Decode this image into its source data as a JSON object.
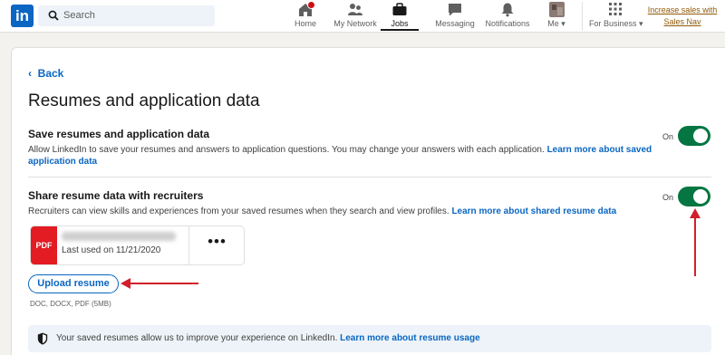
{
  "nav": {
    "logo": "in",
    "search_placeholder": "Search",
    "items": [
      {
        "label": "Home",
        "icon": "home-icon"
      },
      {
        "label": "My Network",
        "icon": "network-icon"
      },
      {
        "label": "Jobs",
        "icon": "briefcase-icon"
      },
      {
        "label": "Messaging",
        "icon": "chat-icon"
      },
      {
        "label": "Notifications",
        "icon": "bell-icon"
      },
      {
        "label": "Me",
        "icon": "avatar"
      },
      {
        "label": "For Business",
        "icon": "grid-icon"
      }
    ],
    "promo_line1": "Increase sales with",
    "promo_line2": "Sales Nav"
  },
  "page": {
    "back_label": "Back",
    "title": "Resumes and application data"
  },
  "save_section": {
    "title": "Save resumes and application data",
    "desc_line1": "Allow LinkedIn to save your resumes and answers to application questions. You may change your answers with each application.",
    "link_part1": "Learn more about saved",
    "link_part2": "application data",
    "toggle_label": "On"
  },
  "share_section": {
    "title": "Share resume data with recruiters",
    "desc": "Recruiters can view skills and experiences from your saved resumes when they search and view profiles.",
    "link": "Learn more about shared resume data",
    "toggle_label": "On"
  },
  "resume_card": {
    "type_label": "PDF",
    "last_used": "Last used on 11/21/2020",
    "more_label": "•••"
  },
  "upload": {
    "button_label": "Upload resume",
    "formats": "DOC, DOCX, PDF (5MB)"
  },
  "info_bar": {
    "text": "Your saved resumes allow us to improve your experience on LinkedIn.",
    "link": "Learn more about resume usage"
  },
  "colors": {
    "brand": "#0a66c2",
    "toggle_on": "#057642",
    "pdf_red": "#e31b23",
    "annotation_arrow": "#d21f2c"
  }
}
